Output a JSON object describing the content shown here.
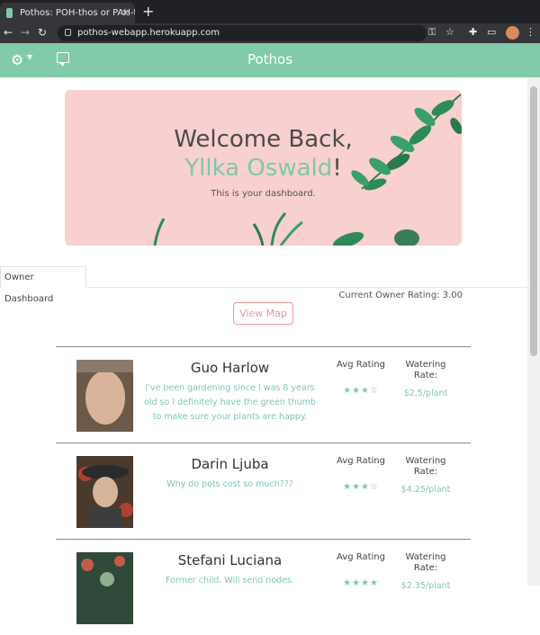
{
  "browser": {
    "tab_title": "Pothos: POH-thos or PAH-thos",
    "url": "pothos-webapp.herokuapp.com"
  },
  "app": {
    "title": "Pothos"
  },
  "hero": {
    "welcome": "Welcome Back,",
    "user_name": "Yllka Oswald",
    "exclaim": "!",
    "subtitle": "This is your dashboard."
  },
  "dashboard": {
    "tab_label": "Owner Dashboard",
    "rating": "Current Owner Rating: 3.00",
    "map_button": "View Map"
  },
  "owners": [
    {
      "name": "Guo Harlow",
      "bio": "I've been gardening since I was 8 years old so I definitely have the green thumb to make sure your plants are happy.",
      "avg_label": "Avg Rating",
      "stars": "★★★☆",
      "watering_label": "Watering Rate:",
      "price": "$2.5/plant"
    },
    {
      "name": "Darin Ljuba",
      "bio": "Why do pots cost so much???",
      "avg_label": "Avg Rating",
      "stars": "★★★☆",
      "watering_label": "Watering Rate:",
      "price": "$4.25/plant"
    },
    {
      "name": "Stefani Luciana",
      "bio": "Former child. Will send nodes.",
      "avg_label": "Avg Rating",
      "stars": "★★★★",
      "watering_label": "Watering Rate:",
      "price": "$2.35/plant"
    }
  ],
  "colors": {
    "accent": "#82cba8",
    "hero_bg": "#f8d0cf",
    "button": "#e89a9a"
  }
}
